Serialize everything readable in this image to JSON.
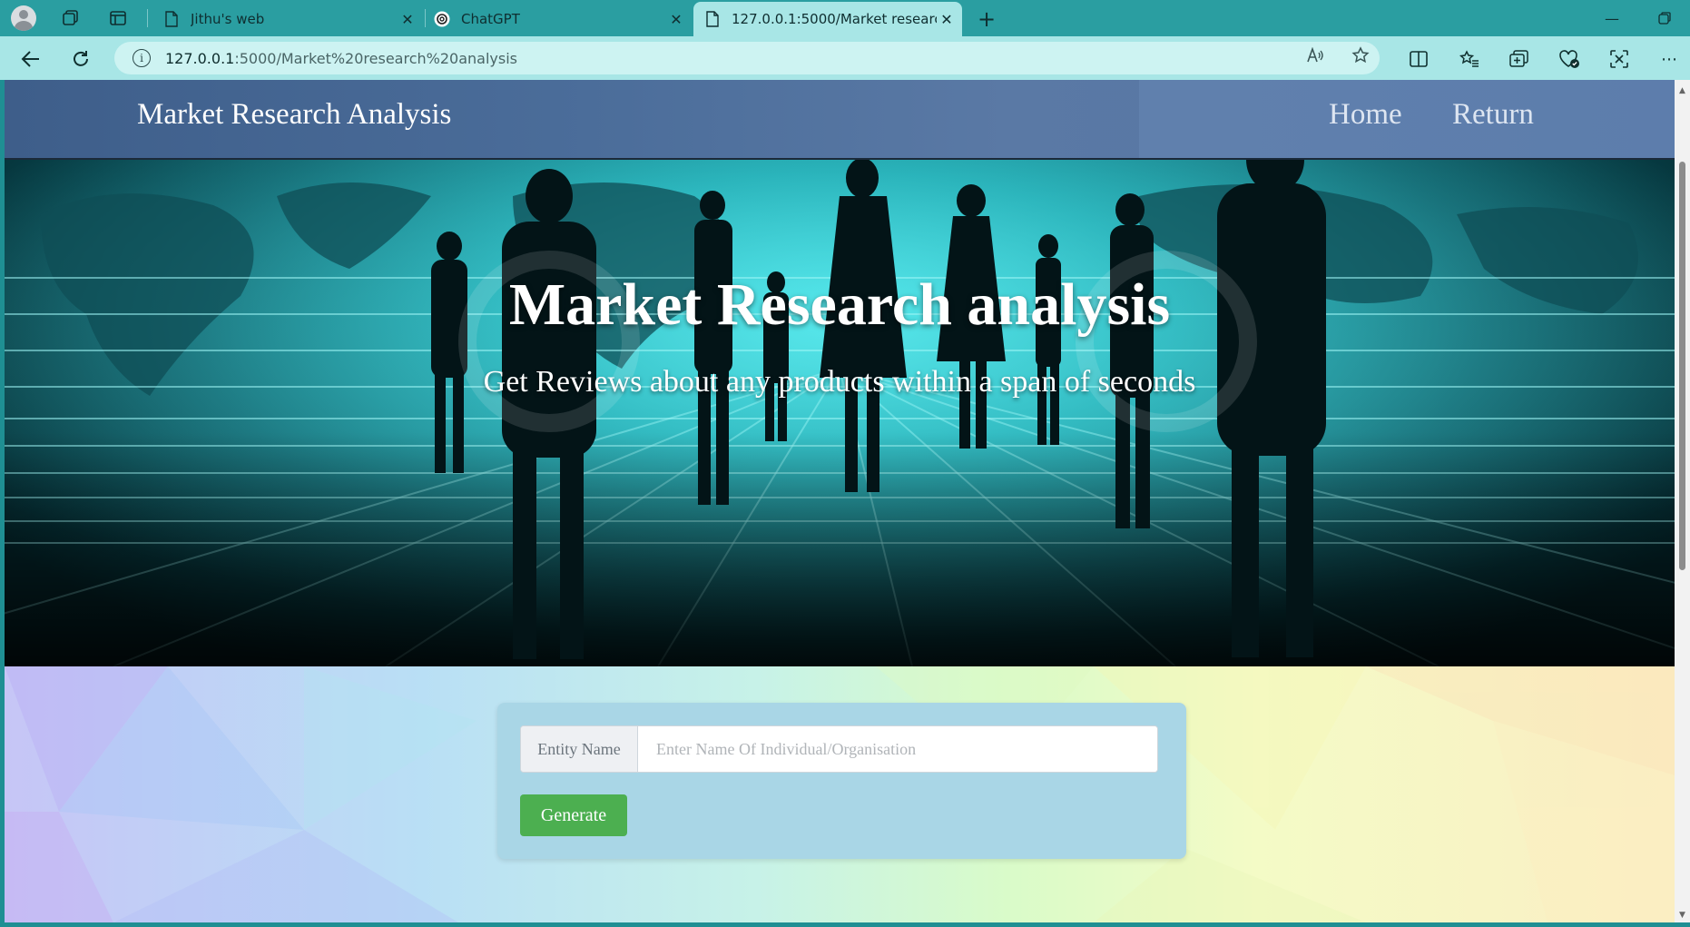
{
  "browser": {
    "tabs": [
      {
        "title": "Jithu's web",
        "icon": "page-icon"
      },
      {
        "title": "ChatGPT",
        "icon": "chatgpt-icon"
      },
      {
        "title": "127.0.0.1:5000/Market research a",
        "icon": "page-icon",
        "active": true
      }
    ],
    "url_host": "127.0.0.1",
    "url_rest": ":5000/Market%20research%20analysis",
    "accent_color": "#2a9ea1",
    "toolbar_color": "#a8e6e6"
  },
  "site": {
    "brand": "Market Research Analysis",
    "nav": {
      "home": "Home",
      "return": "Return"
    }
  },
  "hero": {
    "title": "Market Research analysis",
    "subtitle": "Get Reviews about any products within a span of seconds"
  },
  "form": {
    "label": "Entity Name",
    "placeholder": "Enter Name Of Individual/Organisation",
    "button": "Generate",
    "button_color": "#4caf50"
  }
}
